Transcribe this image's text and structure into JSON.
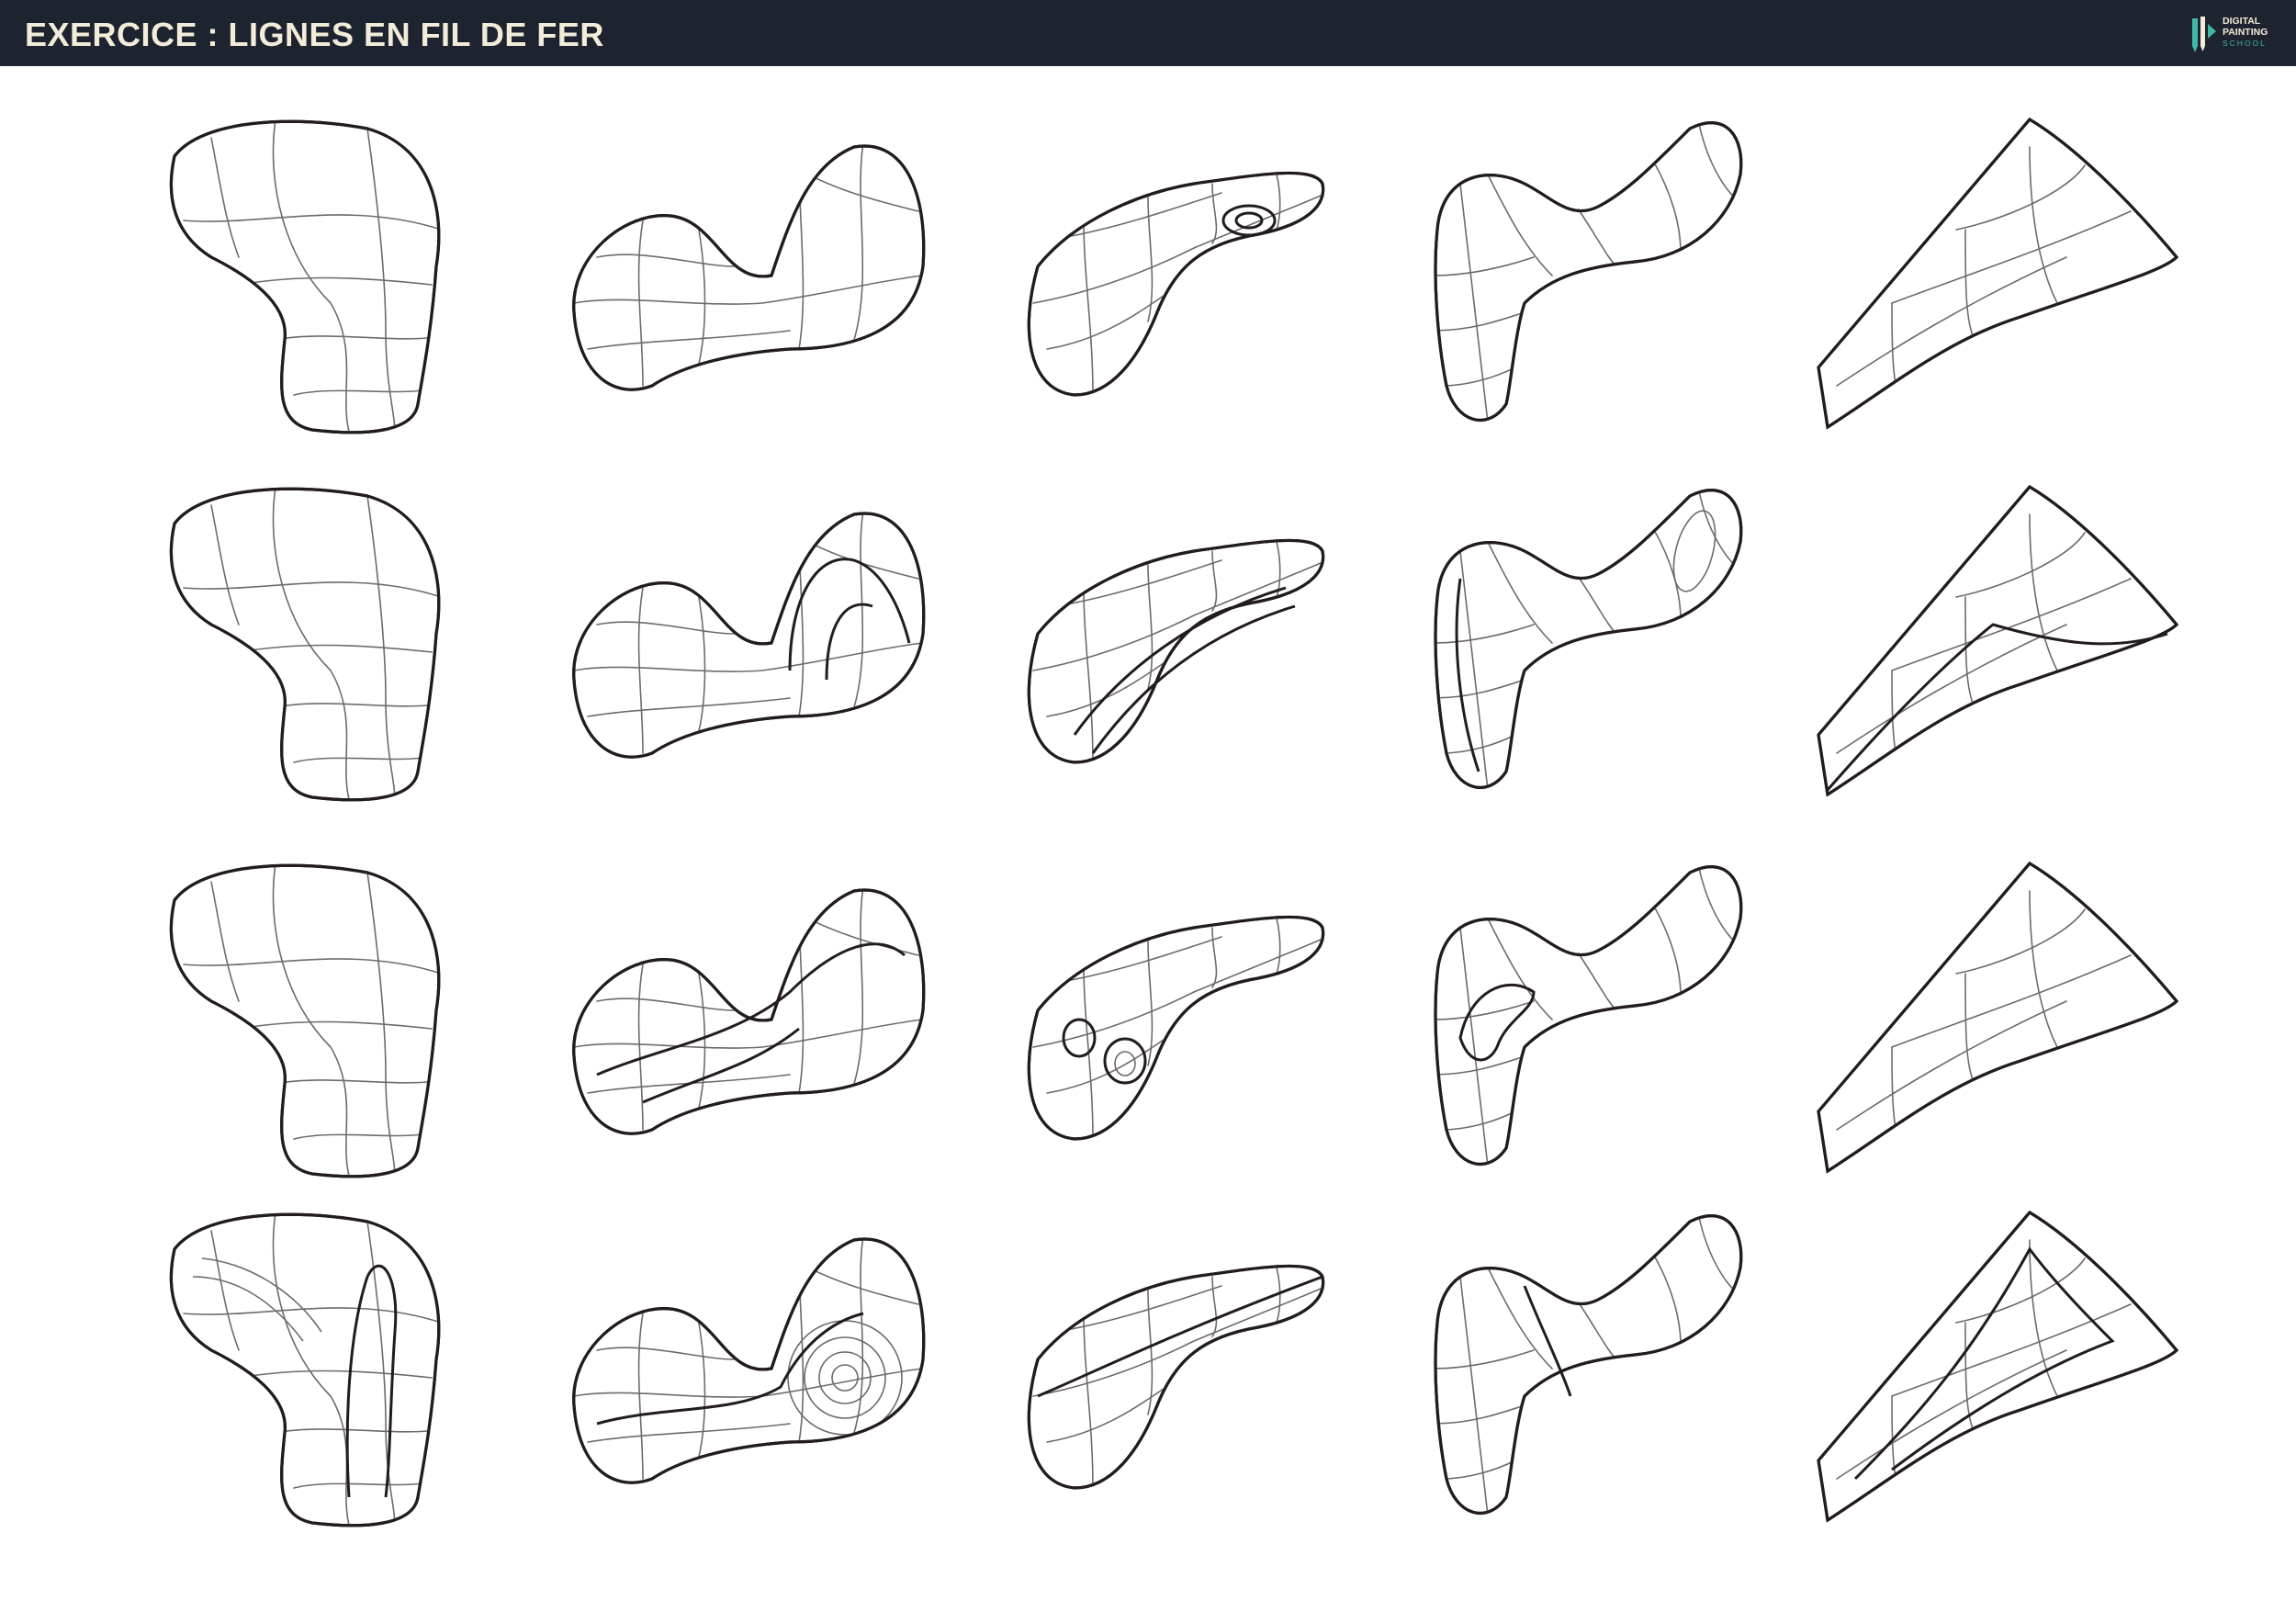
{
  "header": {
    "title": "EXERCICE : LIGNES EN FIL DE FER",
    "logo": {
      "line1": "DIGITAL",
      "line2": "PAINTING",
      "line3": "SCHOOL",
      "icon": "brush-pencil-icon"
    }
  },
  "colors": {
    "header_bg": "#1e2330",
    "title_text": "#f2ecd9",
    "logo_accent": "#3fb8a8",
    "ink": "#231c1c",
    "pencil": "#8a8585"
  },
  "grid": {
    "rows": 4,
    "columns": 5,
    "shapes": [
      "blob",
      "peanut",
      "bean",
      "hook",
      "wedge"
    ]
  }
}
